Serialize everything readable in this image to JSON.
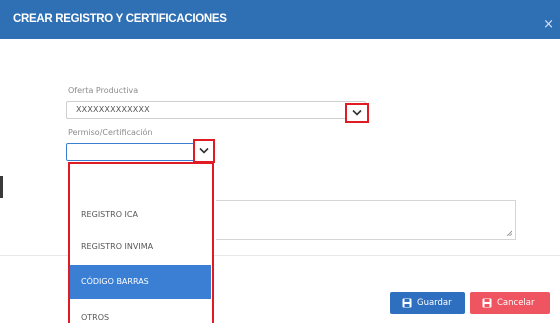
{
  "dialog": {
    "title": "CREAR REGISTRO Y CERTIFICACIONES",
    "close_glyph": "×"
  },
  "form": {
    "oferta_label": "Oferta Productiva",
    "oferta_value": "XXXXXXXXXXXXX",
    "permiso_label": "Permiso/Certificación",
    "permiso_value": ""
  },
  "dropdown": {
    "options": [
      {
        "label": "",
        "selected": false
      },
      {
        "label": "REGISTRO ICA",
        "selected": false
      },
      {
        "label": "REGISTRO INVIMA",
        "selected": false
      },
      {
        "label": "CÓDIGO BARRAS",
        "selected": true
      },
      {
        "label": "OTROS",
        "selected": false
      }
    ]
  },
  "footer": {
    "save_label": "Guardar",
    "cancel_label": "Cancelar"
  },
  "colors": {
    "header": "#2f70b4",
    "highlight": "#e01b24",
    "selected_option": "#3a7fd4",
    "save": "#2f6fbf",
    "cancel": "#ef5560"
  },
  "icons": [
    "close-icon",
    "chevron-down-icon",
    "floppy-disk-icon",
    "resize-handle-icon"
  ]
}
